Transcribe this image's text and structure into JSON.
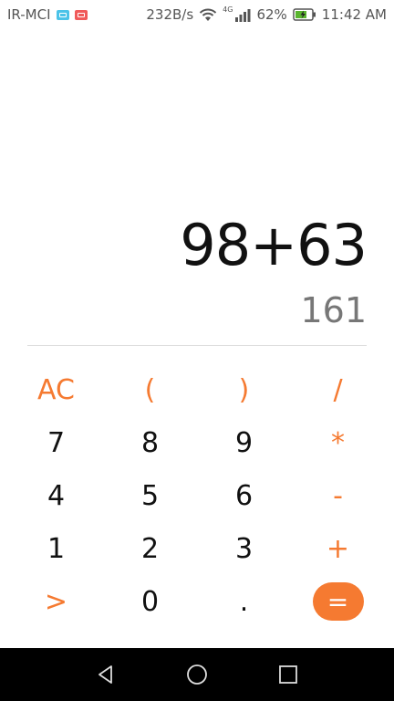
{
  "status_bar": {
    "carrier": "IR-MCI",
    "net_speed": "232B/s",
    "network_type": "4G",
    "battery": "62%",
    "time": "11:42 AM",
    "icons": [
      "message-icon",
      "video-icon",
      "wifi-icon",
      "signal-icon",
      "battery-charging-icon"
    ]
  },
  "display": {
    "expression": "98+63",
    "result": "161"
  },
  "keypad": {
    "row1": [
      "AC",
      "(",
      ")",
      "/"
    ],
    "row2": [
      "7",
      "8",
      "9",
      "*"
    ],
    "row3": [
      "4",
      "5",
      "6",
      "-"
    ],
    "row4": [
      "1",
      "2",
      "3",
      "+"
    ],
    "row5": [
      ">",
      "0",
      ".",
      "="
    ]
  },
  "colors": {
    "accent": "#f57a31",
    "text": "#111111",
    "result_text": "#777777",
    "nav_bar": "#000000"
  },
  "nav_bar": {
    "icons": [
      "back-icon",
      "home-icon",
      "recents-icon"
    ]
  }
}
